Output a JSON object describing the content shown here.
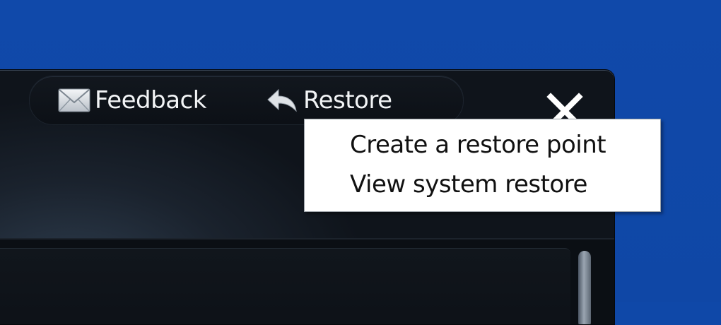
{
  "toolbar": {
    "feedback": {
      "label": "Feedback",
      "icon": "envelope-icon"
    },
    "restore": {
      "label": "Restore",
      "icon": "undo-arrow-icon"
    },
    "close": {
      "icon": "close-icon"
    }
  },
  "restore_menu": {
    "items": [
      {
        "label": "Create a restore point"
      },
      {
        "label": "View system restore"
      }
    ]
  },
  "colors": {
    "desktop": "#0f48a8",
    "window_dark": "#0f141b",
    "menu_bg": "#ffffff",
    "menu_text": "#111111",
    "toolbar_text": "#f2f4f6"
  }
}
